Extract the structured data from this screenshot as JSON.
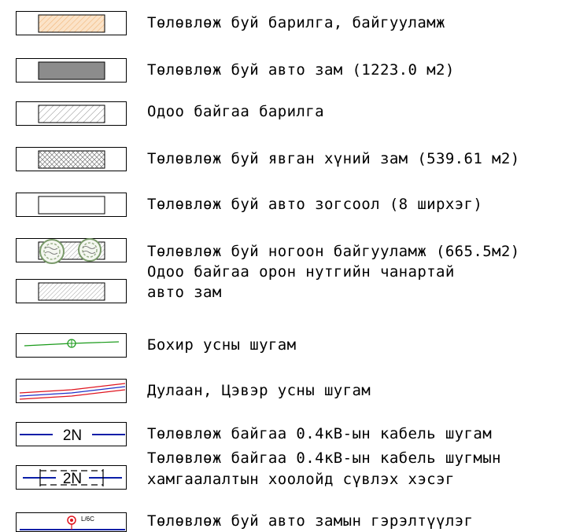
{
  "legend": {
    "items": [
      {
        "label": "Төлөвлөж буй барилга, байгууламж"
      },
      {
        "label": "Төлөвлөж буй авто зам (1223.0 м2)"
      },
      {
        "label": "Одоо байгаа барилга"
      },
      {
        "label": "Төлөвлөж буй явган хүний зам (539.61 м2)"
      },
      {
        "label": "Төлөвлөж буй авто зогсоол (8 ширхэг)"
      },
      {
        "label": "Төлөвлөж буй ногоон байгууламж (665.5м2)"
      },
      {
        "label_line1": "Одоо байгаа орон нутгийн чанартай",
        "label_line2": "авто зам"
      },
      {
        "label": "Бохир усны шугам"
      },
      {
        "label": "Дулаан, Цэвэр усны шугам"
      },
      {
        "label": "Төлөвлөж байгаа 0.4кВ-ын кабель шугам",
        "symbol_text": "2N"
      },
      {
        "label_line1": "Төлөвлөж байгаа 0.4кВ-ын кабель шугмын",
        "label_line2": "хамгаалалтын хоолойд сүвлэх хэсэг",
        "symbol_text": "2N"
      },
      {
        "label": "Төлөвлөж буй авто замын гэрэлтүүлэг",
        "symbol_text": "L/6C"
      }
    ]
  },
  "colors": {
    "building_fill": "#f5c89a",
    "road_fill": "#8c8c8c",
    "sewer_line": "#1a9a1a",
    "heat_line": "#e0141e",
    "water_line": "#2030c8",
    "cable_line": "#0a1ea8",
    "lamp": "#e0141e",
    "green_stroke": "#7a9a6a"
  }
}
